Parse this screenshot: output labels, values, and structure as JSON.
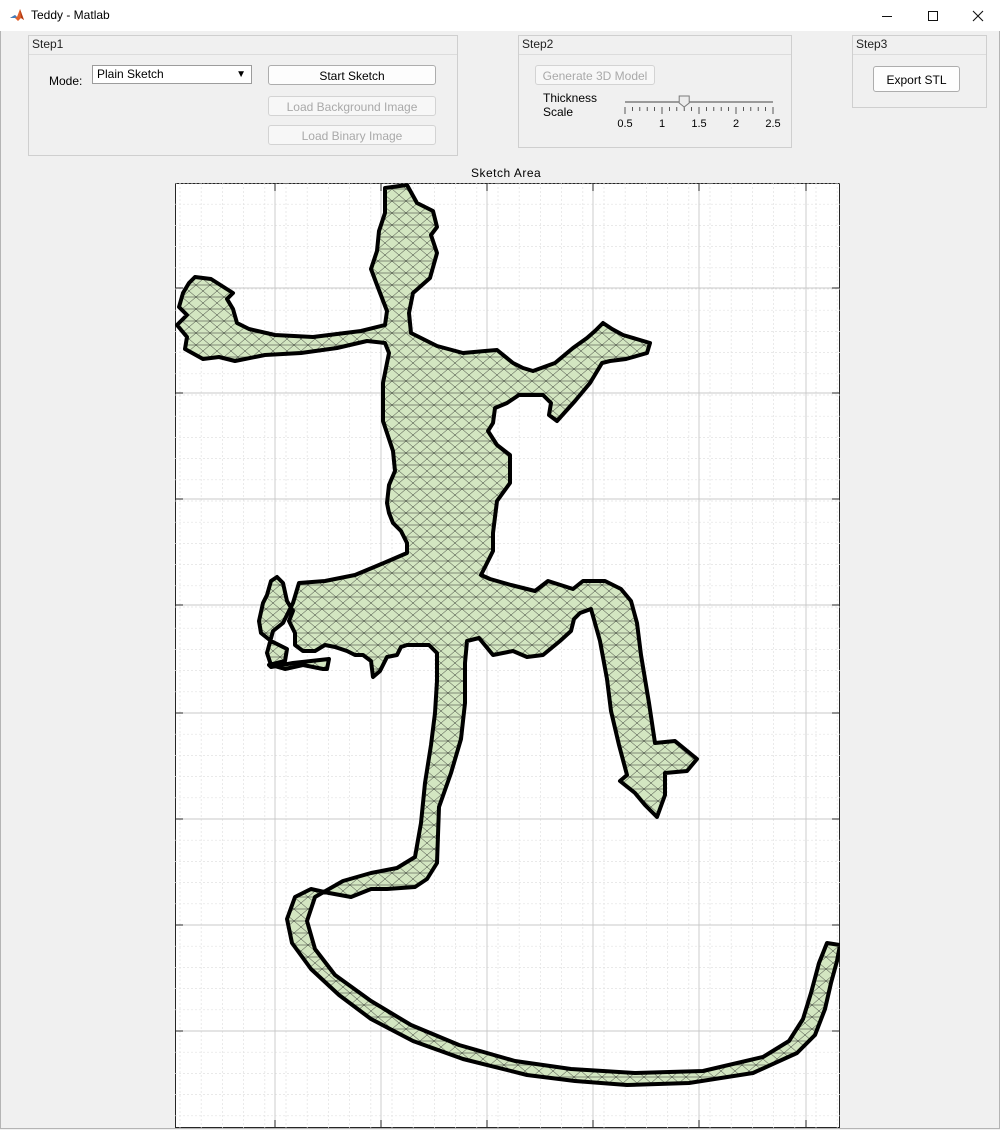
{
  "window": {
    "title": "Teddy - Matlab",
    "minimize_icon": "minimize-icon",
    "maximize_icon": "maximize-icon",
    "close_icon": "close-icon"
  },
  "step1": {
    "title": "Step1",
    "mode_label": "Mode:",
    "mode_value": "Plain Sketch",
    "start_sketch": "Start Sketch",
    "load_background": "Load Background Image",
    "load_binary": "Load Binary Image"
  },
  "step2": {
    "title": "Step2",
    "generate": "Generate 3D Model",
    "thickness_label_1": "Thickness",
    "thickness_label_2": "Scale",
    "slider": {
      "min": 0.5,
      "max": 2.5,
      "value": 1.3,
      "ticks": [
        "0.5",
        "1",
        "1.5",
        "2",
        "2.5"
      ]
    }
  },
  "step3": {
    "title": "Step3",
    "export": "Export STL"
  },
  "sketch": {
    "title": "Sketch Area",
    "mesh_color": "#cfe3bd",
    "edge_color": "#000000",
    "figure": "lizard mesh"
  },
  "colors": {
    "background": "#f0f0f0",
    "grid_major": "#c8c8c8",
    "grid_minor": "#e2e2e2"
  }
}
